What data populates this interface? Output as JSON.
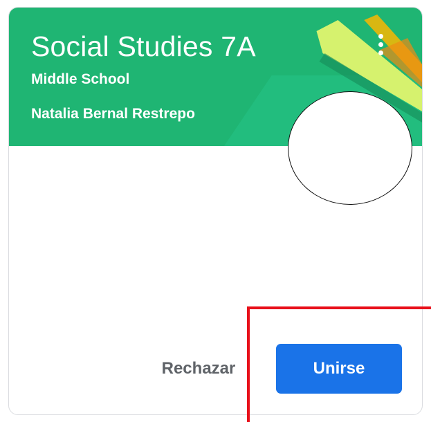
{
  "class_card": {
    "title": "Social Studies 7A",
    "section": "Middle School",
    "teacher": "Natalia Bernal Restrepo",
    "header_color": "#1fb573",
    "menu_icon": "more-vert-icon"
  },
  "actions": {
    "decline_label": "Rechazar",
    "join_label": "Unirse",
    "join_color": "#1a73e8"
  },
  "annotation": {
    "highlight_color": "#e8101a"
  }
}
